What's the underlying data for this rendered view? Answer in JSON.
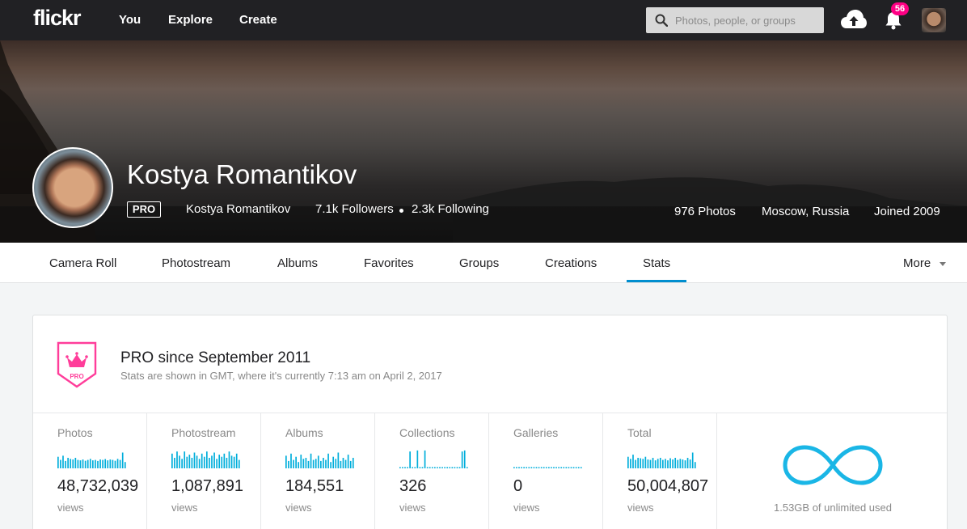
{
  "topbar": {
    "logo": "flickr",
    "nav": [
      "You",
      "Explore",
      "Create"
    ],
    "search_placeholder": "Photos, people, or groups",
    "notification_count": "56",
    "icons": [
      "search-icon",
      "upload-cloud-icon",
      "bell-icon",
      "user-avatar"
    ]
  },
  "profile": {
    "name": "Kostya Romantikov",
    "pro_label": "PRO",
    "username": "Kostya Romantikov",
    "followers": "7.1k Followers",
    "following": "2.3k Following",
    "photos": "976 Photos",
    "location": "Moscow, Russia",
    "joined": "Joined 2009"
  },
  "subnav": {
    "tabs": [
      "Camera Roll",
      "Photostream",
      "Albums",
      "Favorites",
      "Groups",
      "Creations",
      "Stats"
    ],
    "active": "Stats",
    "more_label": "More"
  },
  "stats": {
    "title": "PRO since September 2011",
    "subtitle": "Stats are shown in GMT, where it's currently 7:13 am on April 2, 2017",
    "badge_label": "PRO",
    "accent_color": "#00aedb",
    "badge_color": "#ff3d9a",
    "columns": [
      {
        "label": "Photos",
        "value": "48,732,039",
        "unit": "views"
      },
      {
        "label": "Photostream",
        "value": "1,087,891",
        "unit": "views"
      },
      {
        "label": "Albums",
        "value": "184,551",
        "unit": "views"
      },
      {
        "label": "Collections",
        "value": "326",
        "unit": "views"
      },
      {
        "label": "Galleries",
        "value": "0",
        "unit": "views"
      },
      {
        "label": "Total",
        "value": "50,004,807",
        "unit": "views"
      }
    ],
    "storage_label": "1.53GB of unlimited used"
  }
}
